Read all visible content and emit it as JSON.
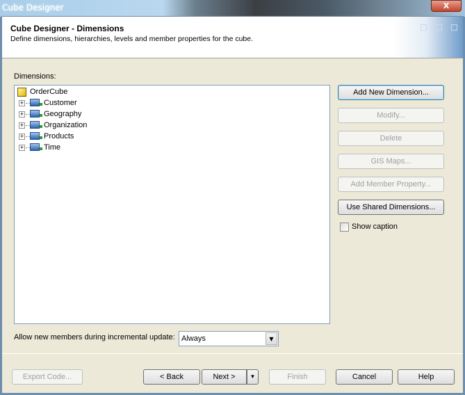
{
  "window": {
    "title": "Cube Designer",
    "close_label": "X"
  },
  "header": {
    "title": "Cube Designer - Dimensions",
    "subtitle": "Define dimensions, hierarchies, levels and member properties for the cube."
  },
  "dimensions_label": "Dimensions:",
  "tree": {
    "root": "OrderCube",
    "items": [
      "Customer",
      "Geography",
      "Organization",
      "Products",
      "Time"
    ]
  },
  "buttons": {
    "add_new_dimension": "Add New Dimension...",
    "modify": "Modify...",
    "delete": "Delete",
    "gis_maps": "GIS Maps...",
    "add_member_property": "Add Member Property...",
    "use_shared_dimensions": "Use Shared Dimensions..."
  },
  "show_caption": {
    "label": "Show caption",
    "checked": false
  },
  "incremental": {
    "label": "Allow new members during incremental update:",
    "value": "Always"
  },
  "footer": {
    "export_code": "Export Code...",
    "back": "< Back",
    "next": "Next >",
    "finish": "Finish",
    "cancel": "Cancel",
    "help": "Help"
  }
}
